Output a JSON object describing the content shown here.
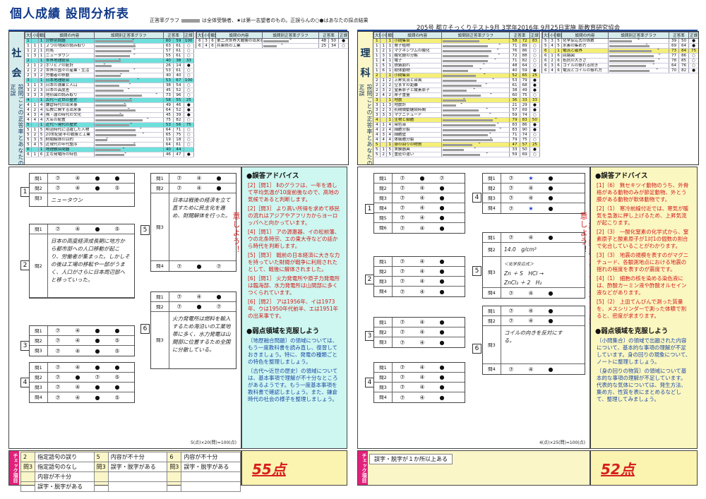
{
  "title": "個人成績 設問分析表",
  "legend": {
    "label": "正答率グラフ",
    "text": "は全体受験者、★は第一志望者のもの。正誤らんの○●はあなたの採点結果"
  },
  "header_info": "205号 都立そっくりテスト9月 3学年2016年 9月25日実施 新教育研究協会",
  "left": {
    "subject_chars": [
      "社",
      "会"
    ],
    "side_note": "設問ごとの正答率とあなたの正誤",
    "columns": [
      "大問",
      "小問",
      "類題",
      "設問の内容",
      "設問別正答率グラフ",
      "正答率",
      "正誤"
    ],
    "rows": [
      {
        "a": "1",
        "b": "",
        "c": "1",
        "t": "分野別問題",
        "g": 60,
        "s": 59,
        "p": "100",
        "r": "",
        "cls": "g"
      },
      {
        "a": "1",
        "b": "1",
        "c": "1",
        "t": "２つの地図の読み取り",
        "g": 63,
        "s": 61,
        "p": "○",
        "r": ""
      },
      {
        "a": "1",
        "b": "2",
        "c": "1",
        "t": "対馬",
        "g": 57,
        "s": 61,
        "p": "○",
        "r": ""
      },
      {
        "a": "1",
        "b": "3",
        "c": "1",
        "t": "ニュータウン",
        "g": 55,
        "s": 61,
        "p": "○",
        "r": ""
      },
      {
        "a": "2",
        "b": "",
        "c": "1",
        "t": "世界地理総合",
        "g": 40,
        "s": 38,
        "p": "33",
        "r": "",
        "cls": "g"
      },
      {
        "a": "2",
        "b": "1",
        "c": "2",
        "t": "ポリビアの統計",
        "g": 26,
        "s": 14,
        "p": "●",
        "r": ""
      },
      {
        "a": "2",
        "b": "2",
        "c": "2",
        "t": "世界の国々の産業・生活",
        "g": 53,
        "s": 61,
        "p": "○",
        "r": ""
      },
      {
        "a": "2",
        "b": "3",
        "c": "2",
        "t": "労働者の移動",
        "g": 40,
        "s": 40,
        "p": "○",
        "r": ""
      },
      {
        "a": "3",
        "b": "",
        "c": "1",
        "t": "日本地理総合",
        "g": 53,
        "s": 67,
        "p": "100",
        "r": "",
        "cls": "g"
      },
      {
        "a": "3",
        "b": "1",
        "c": "3",
        "t": "日本の漁業と人口",
        "g": 38,
        "s": 54,
        "p": "○",
        "r": ""
      },
      {
        "a": "3",
        "b": "2",
        "c": "3",
        "t": "日本の高度差",
        "g": 45,
        "s": 52,
        "p": "○",
        "r": ""
      },
      {
        "a": "3",
        "b": "3",
        "c": "3",
        "t": "地形図の読み取り",
        "g": 73,
        "s": 96,
        "p": "○",
        "r": ""
      },
      {
        "a": "4",
        "b": "",
        "c": "1",
        "t": "古代～近世の歴史",
        "g": 58,
        "s": 55,
        "p": "25",
        "r": "",
        "cls": "g"
      },
      {
        "a": "4",
        "b": "1",
        "c": "4",
        "t": "鎌倉時代の出来事",
        "g": 49,
        "s": 46,
        "p": "●",
        "r": ""
      },
      {
        "a": "4",
        "b": "2",
        "c": "4",
        "t": "仏教に関する出来事",
        "g": 64,
        "s": 52,
        "p": "●",
        "r": ""
      },
      {
        "a": "4",
        "b": "3",
        "c": "4",
        "t": "隋・唐の時代の文化",
        "g": 45,
        "s": 39,
        "p": "●",
        "r": ""
      },
      {
        "a": "4",
        "b": "4",
        "c": "4",
        "t": "大名の配置",
        "g": 75,
        "s": 82,
        "p": "○",
        "r": ""
      },
      {
        "a": "5",
        "b": "",
        "c": "1",
        "t": "近代～現代の歴史",
        "g": 53,
        "s": 56,
        "p": "75",
        "r": "",
        "cls": "g"
      },
      {
        "a": "5",
        "b": "1",
        "c": "5",
        "t": "明治時代に活躍した人物",
        "g": 64,
        "s": 71,
        "p": "○",
        "r": ""
      },
      {
        "a": "5",
        "b": "2",
        "c": "5",
        "t": "20世紀前半の戦後と工業",
        "g": 65,
        "s": 75,
        "p": "○",
        "r": ""
      },
      {
        "a": "5",
        "b": "3",
        "c": "5",
        "t": "財閥解体の目的",
        "g": 19,
        "s": 18,
        "p": "○",
        "r": ""
      },
      {
        "a": "5",
        "b": "4",
        "c": "5",
        "t": "近現代の年代整序",
        "g": 64,
        "s": 61,
        "p": "○",
        "r": ""
      },
      {
        "a": "6",
        "b": "",
        "c": "1",
        "t": "地理融合問題",
        "g": 40,
        "s": 44,
        "p": "",
        "r": "",
        "cls": "g"
      },
      {
        "a": "6",
        "b": "1",
        "c": "6",
        "t": "主な発電所の特色",
        "g": 46,
        "s": 47,
        "p": "●",
        "r": ""
      }
    ],
    "rows2": [
      {
        "a": "6",
        "b": "3",
        "c": "6",
        "t": "第二次世界大戦後の出来事",
        "g": 48,
        "s": 50,
        "p": "●"
      },
      {
        "a": "6",
        "b": "4",
        "c": "6",
        "t": "兵庫県の工業",
        "g": 25,
        "s": 34,
        "p": "○"
      }
    ],
    "advice_title": "●誤答アドバイス",
    "advice": [
      "[2]［問1］ Ⅱのグラフは、一年を通して平均気温が10度前後なので、高地の気候であると判断します。",
      "[2]［問3］ より高い所得を求めて移民の流れはアジアやアフリカからヨーロッパへと向かっています。",
      "[4]［問1］ アの源惠器、イの松前藩、ウの北条時宗、エの東大寺などの話から時代を判断します。",
      "[5]［問3］ 戦前の日本経済に大きな力を持っていた財閥が戦争に利用されたとして、戦後に解体されました。",
      "[6]［問1］ 火力発電所や原子力発電所は臨海部、水力発電所は山間部に多くつくられています。",
      "[6]［問2］ アは1956年、イは1973年、ウは1950年代前半、エは1951年の出来事です。"
    ],
    "weak_title": "●弱点領域を克服しよう",
    "weak": [
      "〔地歴融合問題〕の領域については、もう一度教科書を読み直し、復習しておきましょう。特に、発電の種類ごとの特色を整理しましょう。",
      "〔古代～近世の歴史〕の領域については、基本事項で理解が不十分なところがあるようです。もう一度基本事項を教科書で確認しましょう。また、鎌倉時代の社会の様子を整理しましょう。"
    ],
    "vert_note": "※記述問題は下の✓項目に注意しよう！",
    "check_items": [
      [
        "2",
        "指定語句の誤り",
        "5",
        "内容が不十分",
        "6",
        "内容が不十分"
      ],
      [
        "問3",
        "指定語句のなし",
        "問3",
        "誤字・脱字がある",
        "問3",
        "誤字・脱字がある"
      ],
      [
        "",
        "内容が不十分",
        "",
        "",
        "",
        ""
      ],
      [
        "",
        "誤字・脱字がある",
        "",
        "",
        "",
        ""
      ]
    ],
    "check_label": "チェック項目",
    "score": "55点",
    "foot": "5(点)×20(問)=100(点)",
    "answer_notes": {
      "q1_text": "ニュータウン",
      "q2_text": "日本の高度経済成長期に地方から都市部への人口移動が起こり、労働者が集まった。しかしその後は工場の移転や一部がうまく、人口がさらに日本周辺部へと移っていった。",
      "q5_text": "日本は戦後の経済を立て直すために民主化を進め、財閥解体を行った。",
      "q6_text": "火力発電所は燃料を輸入するため海沿いの工業地帯に多く、水力発電は山間部に位置するため全国に分散している。"
    },
    "question_labels": [
      "問1",
      "問2",
      "問3",
      "問4"
    ]
  },
  "right": {
    "subject_chars": [
      "理",
      "科"
    ],
    "side_note": "設問ごとの正答率とあなたの正誤",
    "rows": [
      {
        "a": "1",
        "b": "",
        "c": "1",
        "t": "小問集合",
        "g": 58,
        "s": 72,
        "p": "83",
        "cls": "y"
      },
      {
        "a": "1",
        "b": "1",
        "c": "1",
        "t": "脊子植物",
        "g": 71,
        "s": 89,
        "p": "○"
      },
      {
        "a": "1",
        "b": "2",
        "c": "1",
        "t": "マグネシウムの酸化",
        "g": 76,
        "s": 86,
        "p": "○"
      },
      {
        "a": "1",
        "b": "3",
        "c": "1",
        "t": "酸化銀の分解",
        "g": 72,
        "s": 88,
        "p": "○"
      },
      {
        "a": "1",
        "b": "4",
        "c": "1",
        "t": "電子",
        "g": 71,
        "s": 82,
        "p": "○"
      },
      {
        "a": "1",
        "b": "5",
        "c": "1",
        "t": "鉄錆割れ",
        "g": 48,
        "s": 64,
        "p": "○"
      },
      {
        "a": "1",
        "b": "6",
        "c": "1",
        "t": "軟体動物",
        "g": 40,
        "s": 59,
        "p": "●"
      },
      {
        "a": "2",
        "b": "",
        "c": "1",
        "t": "小問集合",
        "g": 52,
        "s": 65,
        "p": "25",
        "cls": "y"
      },
      {
        "a": "2",
        "b": "1",
        "c": "2",
        "t": "上昇気流と台風",
        "g": 53,
        "s": 79,
        "p": "●"
      },
      {
        "a": "2",
        "b": "2",
        "c": "2",
        "t": "空ますの距離",
        "g": 61,
        "s": 68,
        "p": "●"
      },
      {
        "a": "2",
        "b": "3",
        "c": "2",
        "t": "窒素原子と酸素原子",
        "g": 38,
        "s": 49,
        "p": "●"
      },
      {
        "a": "2",
        "b": "4",
        "c": "2",
        "t": "岸子重量",
        "g": 60,
        "s": 75,
        "p": "○"
      },
      {
        "a": "3",
        "b": "",
        "c": "1",
        "t": "地震",
        "g": 36,
        "s": 33,
        "p": "33",
        "cls": "y"
      },
      {
        "a": "3",
        "b": "1",
        "c": "3",
        "t": "地震計",
        "g": 21,
        "s": 29,
        "p": "●"
      },
      {
        "a": "3",
        "b": "2",
        "c": "3",
        "t": "初期微動継続時間",
        "g": 57,
        "s": 69,
        "p": "●"
      },
      {
        "a": "3",
        "b": "3",
        "c": "3",
        "t": "マグニチュード",
        "g": 59,
        "s": 74,
        "p": "○"
      },
      {
        "a": "4",
        "b": "",
        "c": "1",
        "t": "生物と細胞",
        "g": 79,
        "s": 83,
        "p": "50",
        "cls": "y"
      },
      {
        "a": "4",
        "b": "1",
        "c": "4",
        "t": "染色液",
        "g": 83,
        "s": 86,
        "p": "●"
      },
      {
        "a": "4",
        "b": "2",
        "c": "4",
        "t": "細胞分裂",
        "g": 83,
        "s": 90,
        "p": "●"
      },
      {
        "a": "4",
        "b": "3",
        "c": "4",
        "t": "細胞壁",
        "g": 71,
        "s": 74,
        "p": "○"
      },
      {
        "a": "4",
        "b": "4",
        "c": "4",
        "t": "体細胞分裂",
        "g": 79,
        "s": 75,
        "p": "○"
      },
      {
        "a": "5",
        "b": "",
        "c": "1",
        "t": "身の回りの物質",
        "g": 47,
        "s": 57,
        "p": "25",
        "cls": "y"
      },
      {
        "a": "5",
        "b": "1",
        "c": "5",
        "t": "実験器具",
        "g": 33,
        "s": 50,
        "p": "●"
      },
      {
        "a": "5",
        "b": "2",
        "c": "5",
        "t": "重密の違い",
        "g": 59,
        "s": 69,
        "p": "○"
      }
    ],
    "rows2": [
      {
        "a": "5",
        "b": "3",
        "c": "5",
        "t": "化学反応式の係数",
        "g": 39,
        "s": 50,
        "p": "●"
      },
      {
        "a": "5",
        "b": "4",
        "c": "5",
        "t": "水素の集め方",
        "g": 69,
        "s": 64,
        "p": "●"
      },
      {
        "a": "6",
        "b": "",
        "c": "1",
        "t": "電流と磁界",
        "g": 73,
        "s": 84,
        "p": "75",
        "cls": "y"
      },
      {
        "a": "6",
        "b": "1",
        "c": "6",
        "t": "回路図",
        "g": 77,
        "s": 86,
        "p": "○"
      },
      {
        "a": "6",
        "b": "2",
        "c": "6",
        "t": "抵抗の大きさ",
        "g": 78,
        "s": 85,
        "p": "○"
      },
      {
        "a": "6",
        "b": "3",
        "c": "6",
        "t": "コイルの振れる向き",
        "g": 64,
        "s": 76,
        "p": "○"
      },
      {
        "a": "6",
        "b": "4",
        "c": "6",
        "t": "電流とコイルの振れ方",
        "g": 70,
        "s": 82,
        "p": "●"
      }
    ],
    "advice_title": "●誤答アドバイス",
    "advice": [
      "[1]（6） 無セキツイ動物のうち、外骨格がある動物のみが節足動物、外とう膜がある動物が軟体動物です。",
      "[2]（1） 寒冷前線付近では、寒気が暖気を急激に押し上げるため、上昇気流が起こります。",
      "[2]（3） 一酸化窒素の化学式から、窒素原子と酸素原子が1対1の個数の割合で化合していることがわかります。",
      "[3]（3） 地震の規模を表すのがマグニチュード、各観測地点における地震の揺れの程度を表すのが震度です。",
      "[4]（1） 細胞の核を染める染色液には、酢酸カーミン液や酢酸オルセイン液などがあります。",
      "[5]（2） 上皿てんびんで測った質量を、メスシリンダーで測った体積で割ると、密度が求まります。"
    ],
    "weak_title": "●弱点領域を克服しよう",
    "weak": [
      "〔小問集合〕の領域で出題された内容について、基本的な事項の理解が不足しています。身の回りの現象について、ノートに整理しましょう。",
      "〔身の回りの物質〕の領域について基本的な事項の理解が不足しています。代表的な気体については、発生方法、集め方、性質を表にまとめるなどして、整理してみましょう。"
    ],
    "vert_note": "※記述問題は下の✓項目に注意しよう！",
    "check_items": [
      [
        "誤字・脱字が１か所以上ある"
      ]
    ],
    "check_label": "チェック項目",
    "score": "52点",
    "foot": "4(点)×25(問)=100(点)",
    "answer_notes": {
      "q5_density": "14.0",
      "q5_unit": "g/cm³",
      "q5_label": "＜化学反応式＞",
      "q5_eq1": "Zn ＋ S　HCl →",
      "q5_eq2": "ZnCl₂ ＋ 2　H₂",
      "q6_text": "コイルの向きを反対にする。"
    },
    "question_labels": [
      "問1",
      "問2",
      "問3",
      "問4",
      "問5",
      "問6"
    ]
  },
  "colors": {
    "accent": "#1e4aa0",
    "advice_bg": "#cdf7f0",
    "header_green": "#6ee0dc",
    "header_yellow": "#f4ef78",
    "mark_red": "#d41a1a"
  }
}
